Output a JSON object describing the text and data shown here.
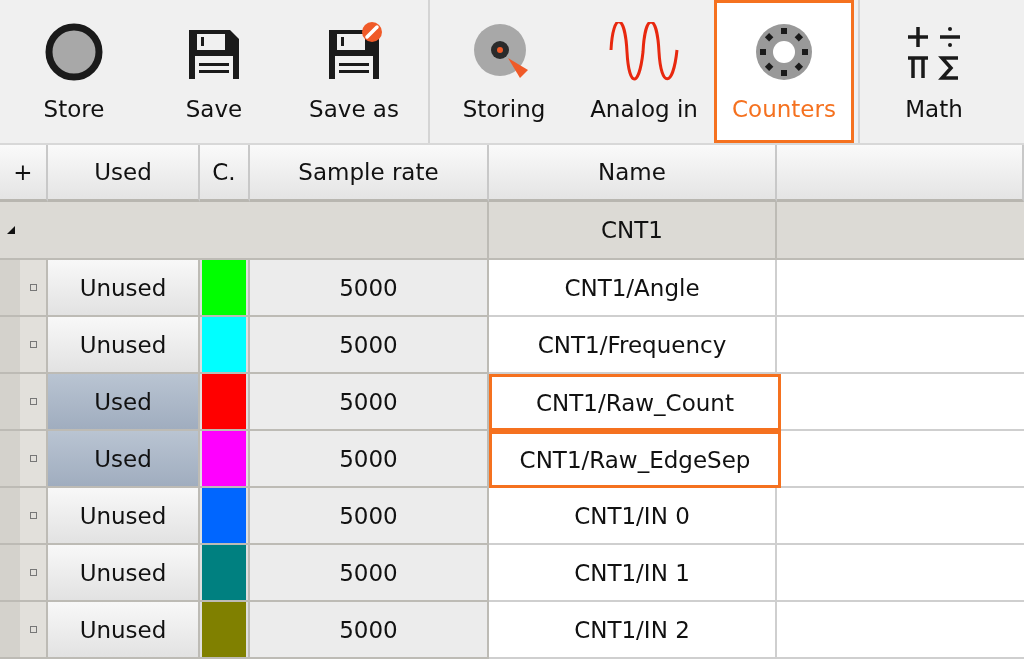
{
  "toolbar": {
    "groups": [
      {
        "tools": [
          {
            "label": "Store",
            "kind": "record",
            "selected": false
          },
          {
            "label": "Save",
            "kind": "save",
            "selected": false
          },
          {
            "label": "Save as",
            "kind": "saveas",
            "selected": false
          }
        ]
      },
      {
        "tools": [
          {
            "label": "Storing",
            "kind": "disk",
            "selected": false
          },
          {
            "label": "Analog in",
            "kind": "wave",
            "selected": false
          },
          {
            "label": "Counters",
            "kind": "counter",
            "selected": true
          }
        ]
      },
      {
        "tools": [
          {
            "label": "Math",
            "kind": "math",
            "selected": false
          }
        ]
      }
    ]
  },
  "table": {
    "columns": [
      "+",
      "Used",
      "C.",
      "Sample rate",
      "Name"
    ],
    "group": {
      "name": "CNT1",
      "expanded": true
    },
    "rows": [
      {
        "used_label": "Unused",
        "used": false,
        "color": "#00ff00",
        "sample_rate": "5000",
        "name": "CNT1/Angle",
        "selected": false
      },
      {
        "used_label": "Unused",
        "used": false,
        "color": "#00ffff",
        "sample_rate": "5000",
        "name": "CNT1/Frequency",
        "selected": false
      },
      {
        "used_label": "Used",
        "used": true,
        "color": "#ff0000",
        "sample_rate": "5000",
        "name": "CNT1/Raw_Count",
        "selected": true
      },
      {
        "used_label": "Used",
        "used": true,
        "color": "#ff00ff",
        "sample_rate": "5000",
        "name": "CNT1/Raw_EdgeSep",
        "selected": true
      },
      {
        "used_label": "Unused",
        "used": false,
        "color": "#0066ff",
        "sample_rate": "5000",
        "name": "CNT1/IN 0",
        "selected": false
      },
      {
        "used_label": "Unused",
        "used": false,
        "color": "#008080",
        "sample_rate": "5000",
        "name": "CNT1/IN 1",
        "selected": false
      },
      {
        "used_label": "Unused",
        "used": false,
        "color": "#808000",
        "sample_rate": "5000",
        "name": "CNT1/IN 2",
        "selected": false
      }
    ]
  }
}
